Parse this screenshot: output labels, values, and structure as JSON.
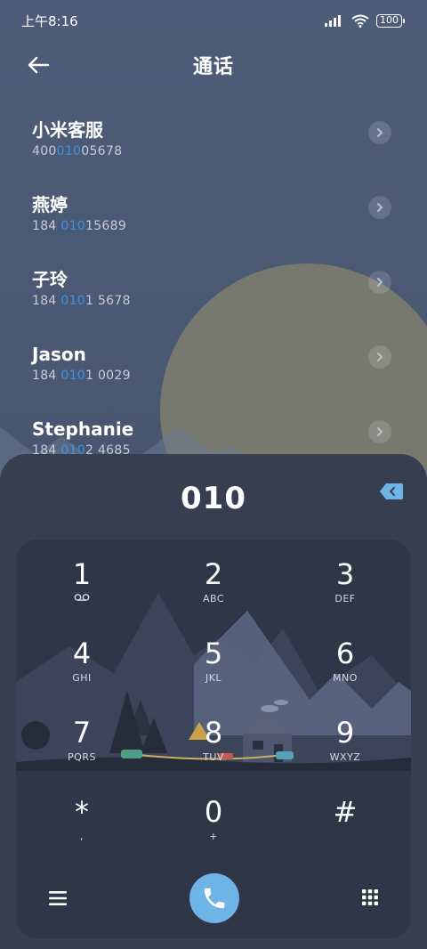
{
  "status": {
    "time": "上午8:16",
    "battery": "100"
  },
  "header": {
    "title": "通话"
  },
  "contacts": [
    {
      "name": "小米客服",
      "num_pre": "400",
      "num_hl": "010",
      "num_post": "05678"
    },
    {
      "name": "燕婷",
      "num_pre": "184 ",
      "num_hl": "010",
      "num_post": "15689"
    },
    {
      "name": "子玲",
      "num_pre": "184 ",
      "num_hl": "010",
      "num_post": "1 5678"
    },
    {
      "name": "Jason",
      "num_pre": "184 ",
      "num_hl": "010",
      "num_post": "1 0029"
    },
    {
      "name": "Stephanie",
      "num_pre": "184 ",
      "num_hl": "010",
      "num_post": "2 4685"
    }
  ],
  "dialer": {
    "input": "010",
    "keys": [
      {
        "d": "1",
        "l": ""
      },
      {
        "d": "2",
        "l": "ABC"
      },
      {
        "d": "3",
        "l": "DEF"
      },
      {
        "d": "4",
        "l": "GHI"
      },
      {
        "d": "5",
        "l": "JKL"
      },
      {
        "d": "6",
        "l": "MNO"
      },
      {
        "d": "7",
        "l": "PQRS"
      },
      {
        "d": "8",
        "l": "TUV"
      },
      {
        "d": "9",
        "l": "WXYZ"
      },
      {
        "d": "*",
        "l": ","
      },
      {
        "d": "0",
        "l": "+"
      },
      {
        "d": "#",
        "l": ""
      }
    ]
  },
  "colors": {
    "accent": "#3b90e6",
    "call_button": "#6fb4e6",
    "sheet": "#363e50"
  },
  "icons": [
    "back-arrow-icon",
    "signal-icon",
    "wifi-icon",
    "battery-icon",
    "chevron-right-icon",
    "backspace-icon",
    "voicemail-icon",
    "menu-icon",
    "phone-icon",
    "keypad-icon"
  ]
}
